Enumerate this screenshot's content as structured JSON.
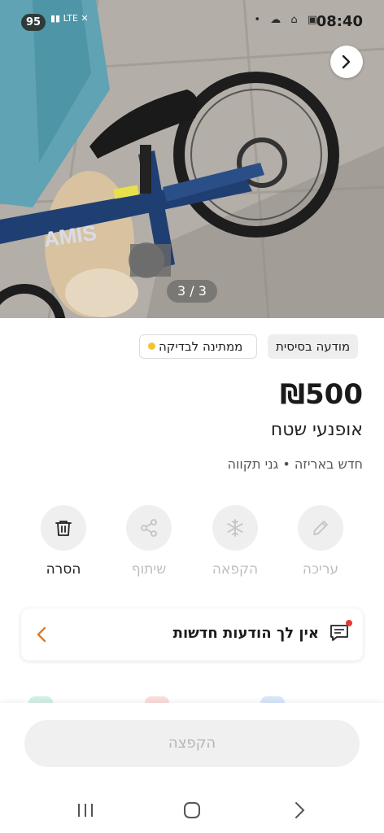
{
  "status_bar": {
    "battery": "95",
    "network": "LTE",
    "time": "08:40"
  },
  "gallery": {
    "counter": "3 / 3",
    "frame_label": "AMIS"
  },
  "badges": {
    "basic": "מודעה בסיסית",
    "pending": "ממתינה לבדיקה"
  },
  "listing": {
    "price": "₪500",
    "title": "אופנעי שטח",
    "meta": "חדש באריזה • גני תקווה"
  },
  "actions": [
    {
      "label": "עריכה",
      "icon": "pencil-icon",
      "enabled": false
    },
    {
      "label": "הקפאה",
      "icon": "snowflake-icon",
      "enabled": false
    },
    {
      "label": "שיתוף",
      "icon": "share-icon",
      "enabled": false
    },
    {
      "label": "הסרה",
      "icon": "trash-icon",
      "enabled": true
    }
  ],
  "messages": {
    "text": "אין לך הודעות חדשות"
  },
  "bottom": {
    "promote_label": "הקפצה"
  },
  "colors": {
    "accent_orange": "#e07a1f",
    "pending_dot": "#f4c430",
    "notification_dot": "#e53935"
  }
}
